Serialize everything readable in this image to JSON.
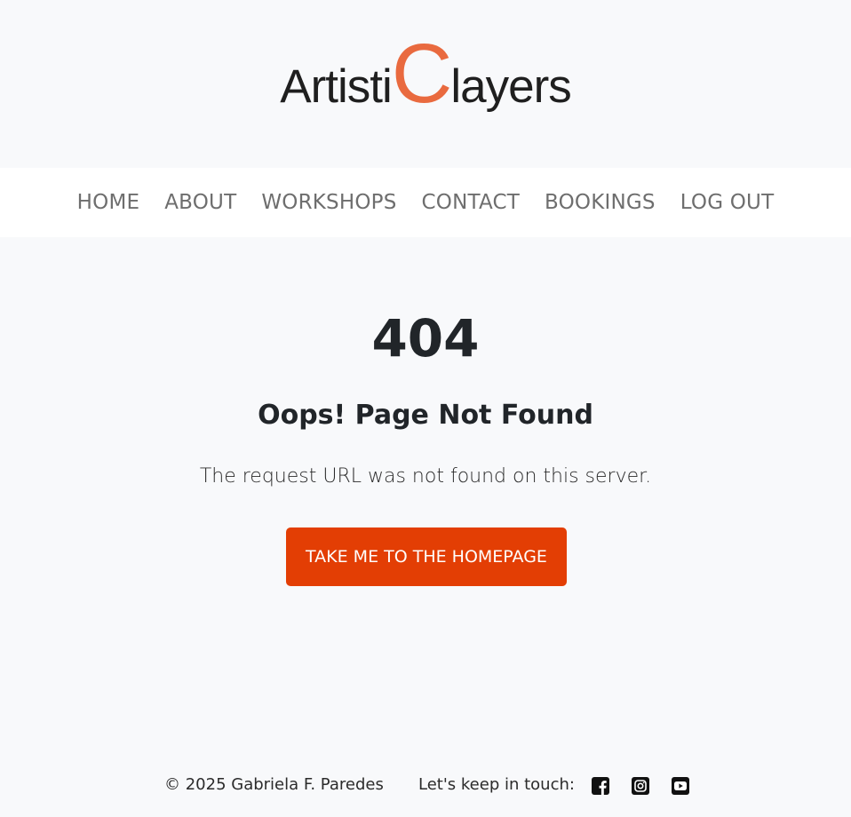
{
  "logo": {
    "part1": "Artisti",
    "big_letter": "C",
    "part2": "layers",
    "accent_color": "#e96a3f"
  },
  "nav": {
    "items": [
      {
        "label": "HOME"
      },
      {
        "label": "ABOUT"
      },
      {
        "label": "WORKSHOPS"
      },
      {
        "label": "CONTACT"
      },
      {
        "label": "BOOKINGS"
      },
      {
        "label": "LOG OUT"
      }
    ]
  },
  "error": {
    "code": "404",
    "title": "Oops! Page Not Found",
    "message": "The request URL was not found on this server.",
    "button_label": "TAKE ME TO THE HOMEPAGE",
    "button_color": "#e33e04"
  },
  "footer": {
    "copyright": "© 2025 Gabriela F. Paredes",
    "touch_label": "Let's keep in touch:",
    "social": [
      {
        "icon": "facebook-icon"
      },
      {
        "icon": "instagram-icon"
      },
      {
        "icon": "youtube-icon"
      }
    ]
  }
}
